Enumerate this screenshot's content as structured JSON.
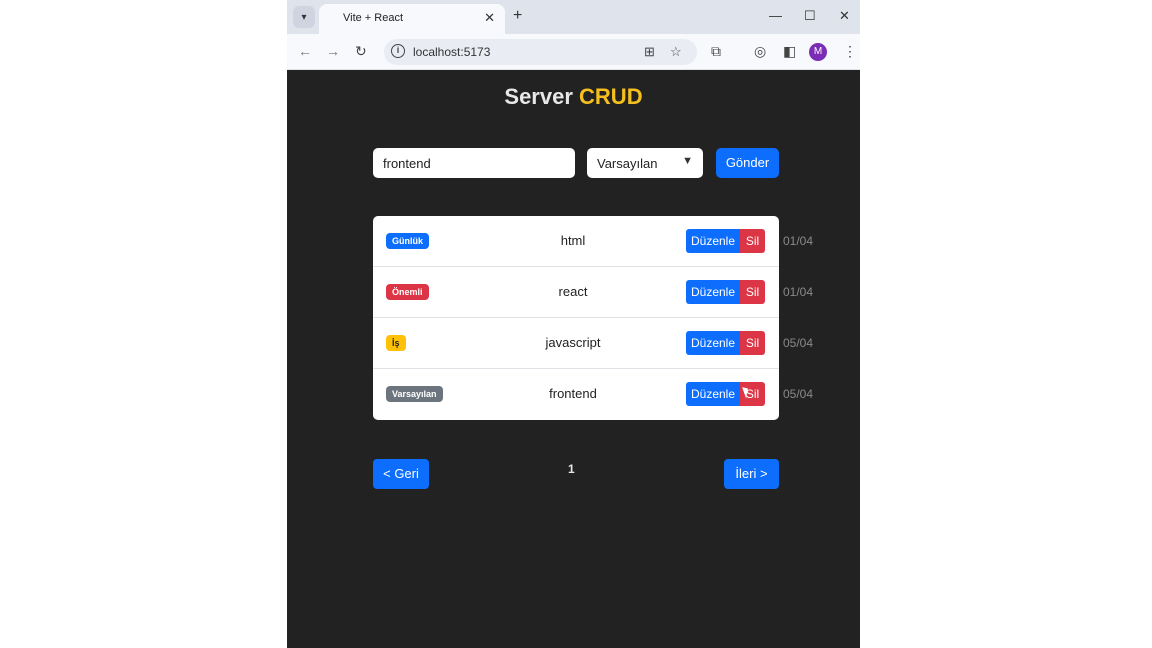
{
  "browser": {
    "tab_title": "Vite + React",
    "url": "localhost:5173",
    "profile_initial": "M"
  },
  "page": {
    "title_main": "Server",
    "title_accent": "CRUD",
    "accent_color": "#f5c01e"
  },
  "form": {
    "input_value": "frontend",
    "select_value": "Varsayılan",
    "submit_label": "Gönder"
  },
  "items": [
    {
      "badge": "Günlük",
      "badge_color": "#0d6efd",
      "text": "html",
      "edit_label": "Düzenle",
      "delete_label": "Sil",
      "date": "01/04"
    },
    {
      "badge": "Önemli",
      "badge_color": "#dc3545",
      "text": "react",
      "edit_label": "Düzenle",
      "delete_label": "Sil",
      "date": "01/04"
    },
    {
      "badge": "İş",
      "badge_color": "#ffc107",
      "text": "javascript",
      "edit_label": "Düzenle",
      "delete_label": "Sil",
      "date": "05/04"
    },
    {
      "badge": "Varsayılan",
      "badge_color": "#6c757d",
      "text": "frontend",
      "edit_label": "Düzenle",
      "delete_label": "Sil",
      "date": "05/04"
    }
  ],
  "pagination": {
    "prev_label": "< Geri",
    "current_page": "1",
    "next_label": "İleri >"
  }
}
